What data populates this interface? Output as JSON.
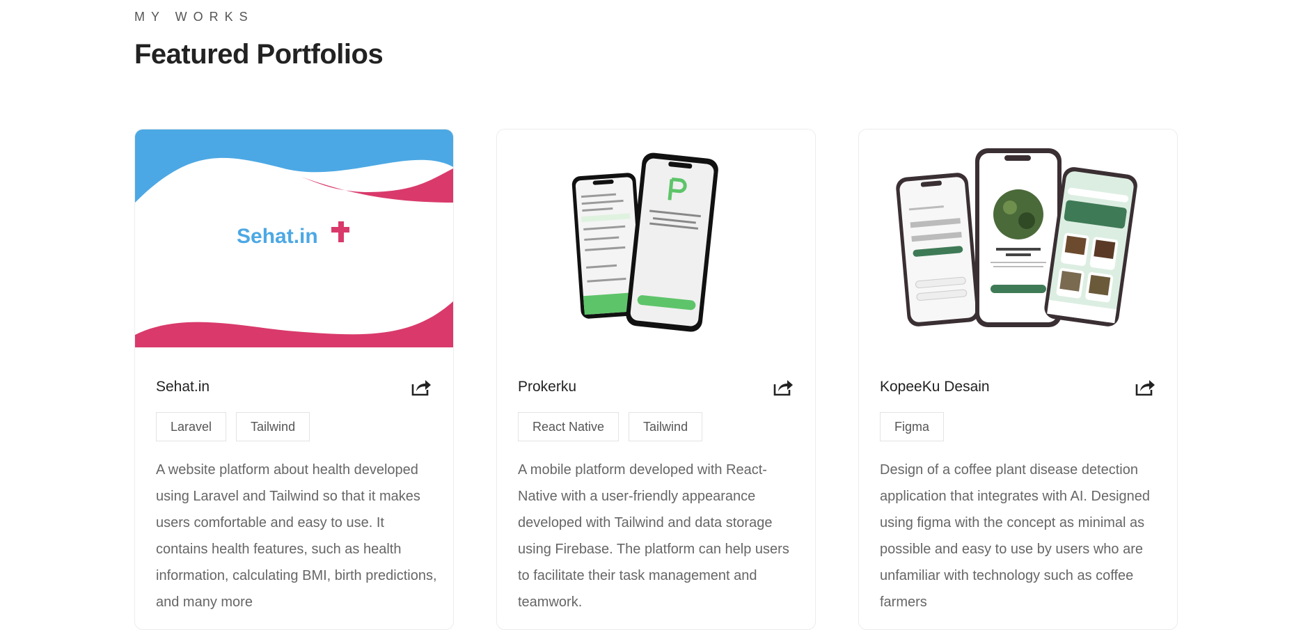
{
  "section": {
    "eyebrow": "MY WORKS",
    "title": "Featured Portfolios"
  },
  "colors": {
    "sehat_blue": "#4ca8e4",
    "sehat_pink": "#d93a6b",
    "prokerku_green": "#5ec46a",
    "kopeeku_green": "#3f7a56"
  },
  "cards": [
    {
      "title": "Sehat.in",
      "logo_text": "Sehat.in",
      "tags": [
        "Laravel",
        "Tailwind"
      ],
      "description": "A website platform about health developed using Laravel and Tailwind so that it makes users comfortable and easy to use. It contains health features, such as health information, calculating BMI, birth predictions, and many more",
      "share_icon": "share-external-icon"
    },
    {
      "title": "Prokerku",
      "tags": [
        "React Native",
        "Tailwind"
      ],
      "description": "A mobile platform developed with React-Native with a user-friendly appearance developed with Tailwind and data storage using Firebase. The platform can help users to facilitate their task management and teamwork.",
      "share_icon": "share-external-icon"
    },
    {
      "title": "KopeeKu Desain",
      "tags": [
        "Figma"
      ],
      "description": "Design of a coffee plant disease detection application that integrates with AI. Designed using figma with the concept as minimal as possible and easy to use by users who are unfamiliar with technology such as coffee farmers",
      "share_icon": "share-external-icon"
    }
  ]
}
